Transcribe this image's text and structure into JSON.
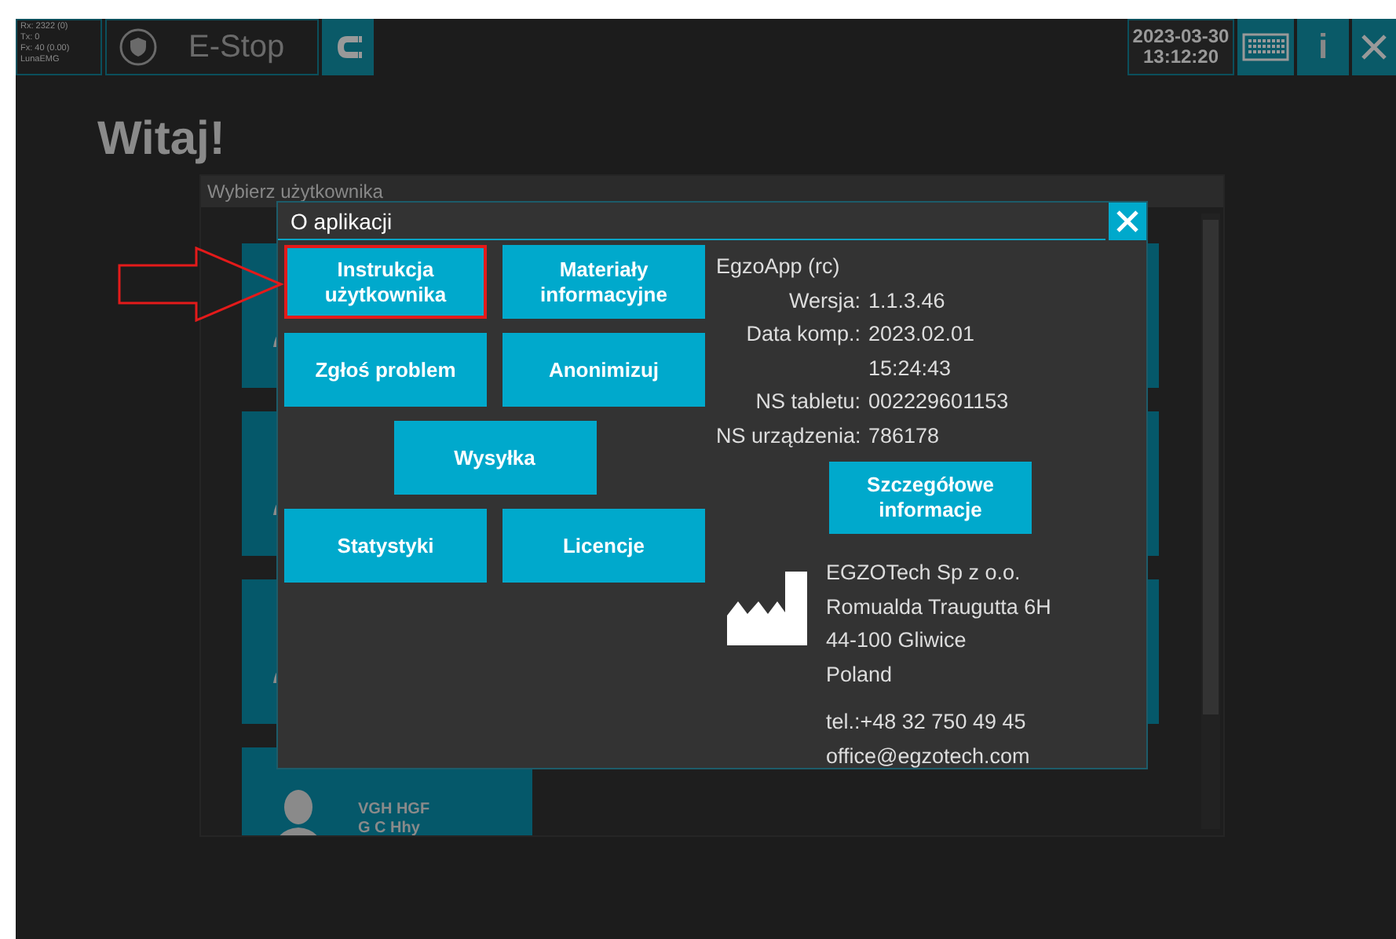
{
  "status_box": {
    "lines": [
      "Rx: 2322 (0)",
      "Tx: 0",
      "Fx: 40 (0.00)",
      "LunaEMG"
    ]
  },
  "estop": {
    "label": "E-Stop",
    "disabled": true
  },
  "clock": {
    "date": "2023-03-30",
    "time": "13:12:20"
  },
  "info_button": {
    "label": "i"
  },
  "title": "Witaj!",
  "user_panel": {
    "header": "Wybierz użytkownika",
    "users": [
      {
        "kind": "covered"
      },
      {
        "kind": "covered"
      },
      {
        "kind": "covered"
      },
      {
        "kind": "named",
        "lines": [
          "VGH HGF",
          "G C Hhy"
        ]
      }
    ]
  },
  "dialog": {
    "title": "O aplikacji",
    "button_rows": [
      [
        {
          "label": "Instrukcja użytkownika",
          "highlighted": true
        },
        {
          "label": "Materiały informacyjne",
          "highlighted": false
        }
      ],
      [
        {
          "label": "Zgłoś problem",
          "highlighted": false
        },
        {
          "label": "Anonimizuj",
          "highlighted": false
        }
      ],
      [
        {
          "label": "Wysyłka",
          "highlighted": false
        }
      ],
      [
        {
          "label": "Statystyki",
          "highlighted": false
        },
        {
          "label": "Licencje",
          "highlighted": false
        }
      ]
    ],
    "app_name": "EgzoApp (rc)",
    "fields": [
      {
        "label": "Wersja:",
        "value": "1.1.3.46"
      },
      {
        "label": "Data komp.:",
        "value": "2023.02.01"
      },
      {
        "value": "15:24:43"
      },
      {
        "label": "NS tabletu:",
        "value": "002229601153"
      },
      {
        "label": "NS urządzenia:",
        "value": "786178"
      }
    ],
    "details_button": "Szczegółowe informacje",
    "manufacturer": [
      "EGZOTech Sp z o.o.",
      "Romualda Traugutta 6H",
      "44-100 Gliwice",
      "Poland"
    ],
    "contact": [
      "tel.:+48 32 750 49 45",
      "office@egzotech.com"
    ]
  },
  "annotation": {
    "kind": "arrow"
  }
}
